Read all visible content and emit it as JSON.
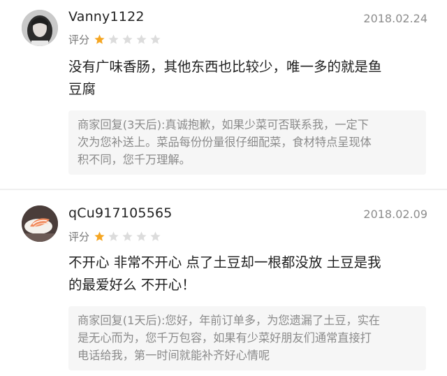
{
  "reviews": [
    {
      "username": "Vanny1122",
      "date": "2018.02.24",
      "rating_label": "评分",
      "rating": 1,
      "rating_max": 5,
      "comment": "没有广味香肠，其他东西也比较少，唯一多的就是鱼\n豆腐",
      "reply": "商家回复(3天后):真诚抱歉，如果少菜可否联系我，一定下\n次为您补送上。菜品每份份量很仔细配菜，食材特点呈现体\n积不同，您千万理解。"
    },
    {
      "username": "qCu917105565",
      "date": "2018.02.09",
      "rating_label": "评分",
      "rating": 1,
      "rating_max": 5,
      "comment": "不开心 非常不开心 点了土豆却一根都没放 土豆是我\n的最爱好么 不开心！",
      "reply": "商家回复(1天后):您好，年前订单多，为您遗漏了土豆，实在\n是无心而为，您千万包容，如果有少菜好朋友们通常直接打\n电话给我，第一时间就能补齐好心情呢"
    }
  ],
  "colors": {
    "star_filled": "#f5a623",
    "star_empty": "#dcdcdc",
    "reply_bg": "#f6f6f6"
  },
  "icons": {
    "star": "star-icon",
    "avatar_1": "avatar-photo-portrait",
    "avatar_2": "avatar-photo-sashimi"
  }
}
